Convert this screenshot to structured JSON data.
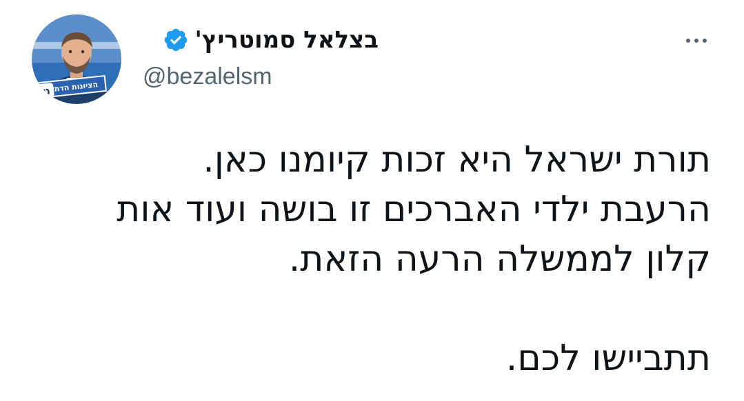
{
  "author": {
    "display_name": "בצלאל סמוטריץ'",
    "handle": "@bezalelsm",
    "verified": true,
    "avatar_badge_text": "הציונות הדתית",
    "avatar_badge_letter": "ט"
  },
  "tweet": {
    "lines": [
      "תורת ישראל היא זכות קיומנו כאן.",
      "הרעבת ילדי האברכים זו בושה ועוד אות",
      "קלון לממשלה הרעה הזאת.",
      "",
      "תתביישו לכם."
    ]
  },
  "icons": {
    "verified": "verified-badge-icon",
    "more": "more-options-icon"
  },
  "colors": {
    "verified_blue": "#1d9bf0",
    "text_primary": "#0f1419",
    "text_secondary": "#536471"
  }
}
